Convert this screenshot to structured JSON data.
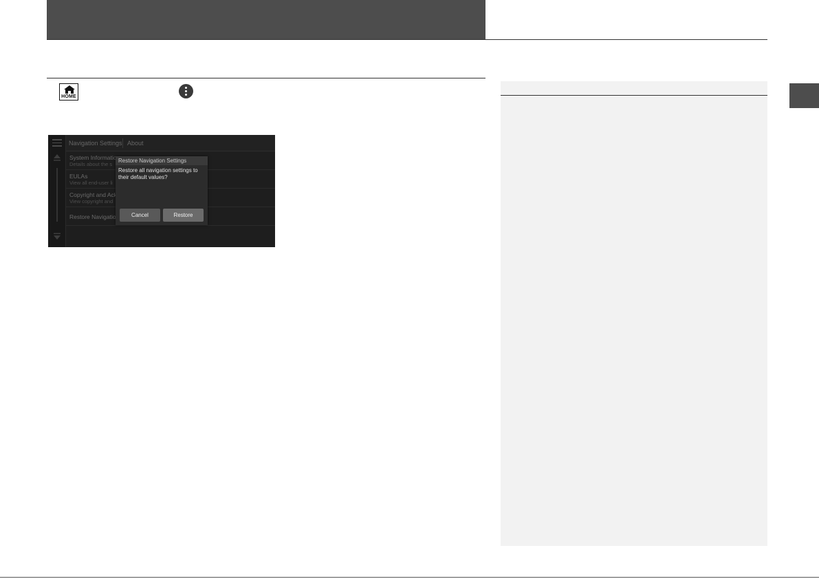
{
  "screen": {
    "topbar": {
      "title": "Navigation Settings",
      "about": "About"
    },
    "menu_items": [
      {
        "title": "System Information",
        "subtitle": "Details about the s"
      },
      {
        "title": "EULAs",
        "subtitle": "View all end-user li"
      },
      {
        "title": "Copyright and Ack",
        "subtitle": "View copyright and"
      },
      {
        "title": "Restore Navigation",
        "subtitle": ""
      }
    ],
    "dialog": {
      "title": "Restore Navigation Settings",
      "message": "Restore all navigation settings to their default values?",
      "cancel_label": "Cancel",
      "restore_label": "Restore"
    }
  },
  "icons": {
    "home": {
      "name": "home-icon",
      "label": "HOME"
    },
    "more": {
      "name": "more-options-icon"
    }
  },
  "colors": {
    "header": "#4d4d4d",
    "sidebar": "#f2f2f2",
    "screen_bg": "#1e1e1e",
    "dialog_bg": "#2c2c2c"
  }
}
